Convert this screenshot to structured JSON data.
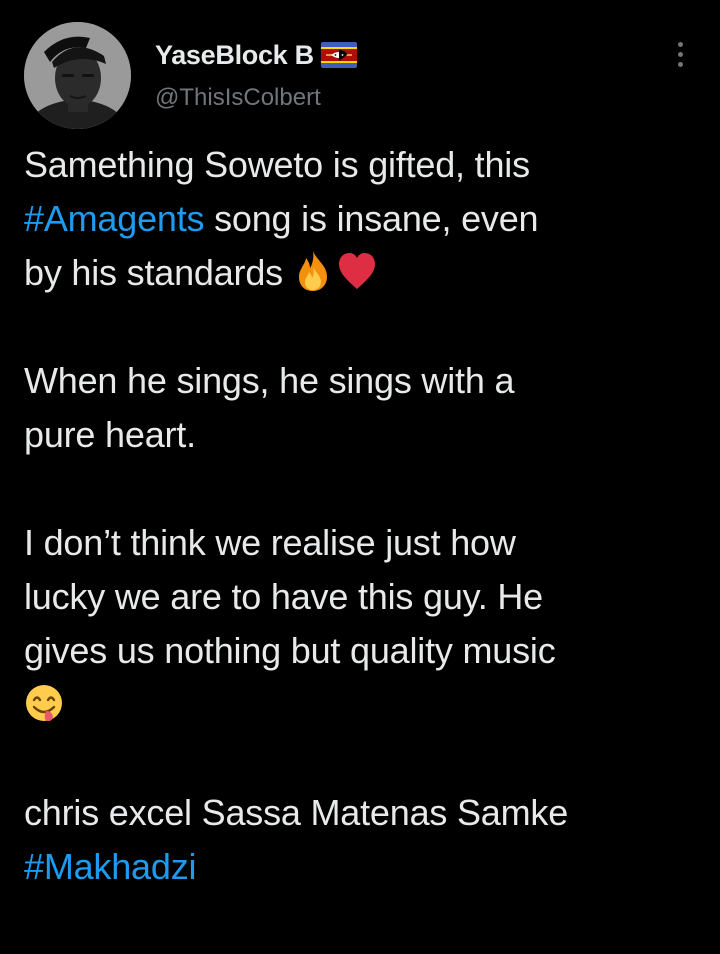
{
  "tweet": {
    "author": {
      "display_name": "YaseBlock B",
      "flag_icon": "eswatini-flag-icon",
      "handle": "@ThisIsColbert",
      "avatar": "avatar-photo"
    },
    "more_icon": "more-vertical-icon",
    "paragraphs": {
      "p1": {
        "l1": "Samething Soweto is gifted, this",
        "l2_hashtag": "#Amagents",
        "l2_rest": " song is insane, even",
        "l3": "by his standards "
      },
      "p2": {
        "l1": "When he sings, he sings with a",
        "l2": "pure heart."
      },
      "p3": {
        "l1": "I don’t think we realise just how",
        "l2": "lucky we are to have this guy. He",
        "l3": "gives us nothing but quality music"
      },
      "p4": {
        "l1": "chris excel Sassa Matenas Samke",
        "l2_hashtag": "#Makhadzi"
      }
    },
    "emojis": [
      "fire-emoji",
      "red-heart-emoji",
      "face-savoring-food-emoji"
    ],
    "colors": {
      "background": "#000000",
      "text": "#e7e9ea",
      "secondary": "#71767b",
      "link": "#1d9bf0"
    }
  }
}
